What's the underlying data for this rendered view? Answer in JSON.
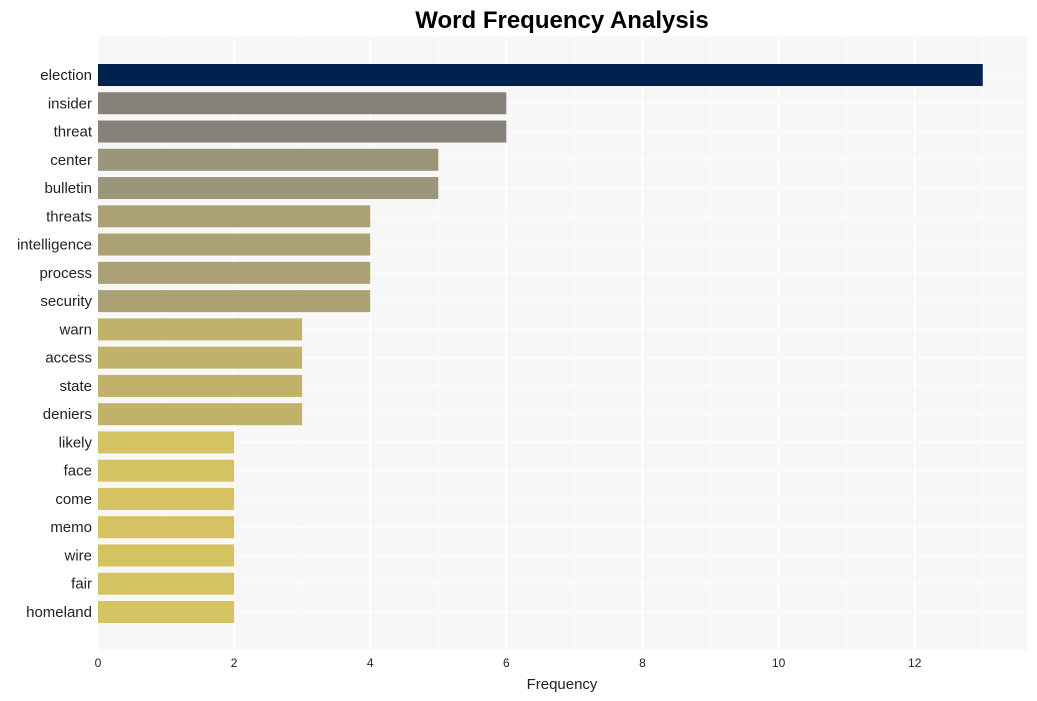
{
  "chart_data": {
    "type": "bar",
    "orientation": "horizontal",
    "title": "Word Frequency Analysis",
    "xlabel": "Frequency",
    "ylabel": "",
    "xlim": [
      0,
      13.65
    ],
    "xticks": [
      0,
      2,
      4,
      6,
      8,
      10,
      12
    ],
    "grid": true,
    "legend": "none",
    "categories": [
      "election",
      "insider",
      "threat",
      "center",
      "bulletin",
      "threats",
      "intelligence",
      "process",
      "security",
      "warn",
      "access",
      "state",
      "deniers",
      "likely",
      "face",
      "come",
      "memo",
      "wire",
      "fair",
      "homeland"
    ],
    "values": [
      13,
      6,
      6,
      5,
      5,
      4,
      4,
      4,
      4,
      3,
      3,
      3,
      3,
      2,
      2,
      2,
      2,
      2,
      2,
      2
    ],
    "colors": [
      "#00224e",
      "#878279",
      "#878279",
      "#9b9579",
      "#9b9579",
      "#aba174",
      "#aba174",
      "#aba174",
      "#aba174",
      "#c0b16b",
      "#c0b16b",
      "#c0b16b",
      "#c0b16b",
      "#d5c261",
      "#d5c261",
      "#d5c261",
      "#d5c261",
      "#d5c261",
      "#d5c261",
      "#d5c261"
    ]
  },
  "style": {
    "plot_background": "#f7f7f7",
    "grid_color": "#ffffff"
  }
}
